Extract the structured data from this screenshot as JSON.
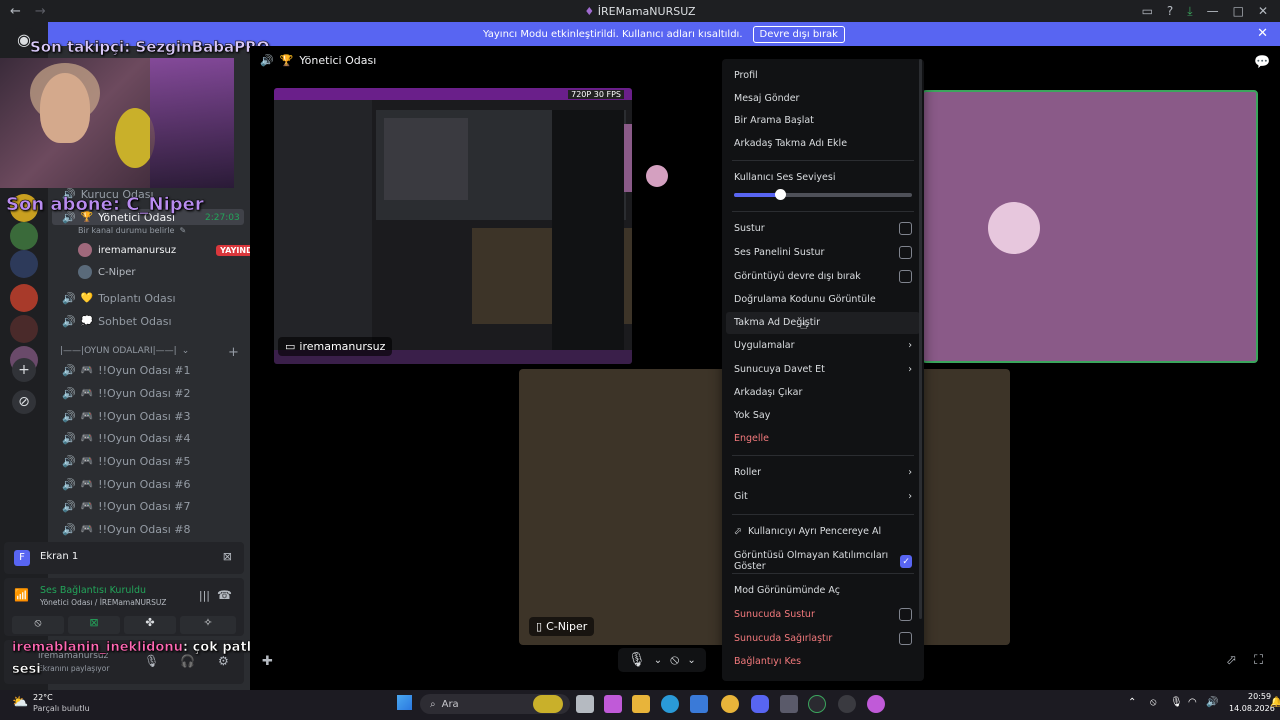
{
  "window": {
    "title": "İREMamaNURSUZ",
    "nav_back": "←",
    "nav_forward": "→",
    "right_icons": [
      "inbox-icon",
      "help-icon",
      "download-icon",
      "minimize-icon",
      "maximize-icon",
      "close-icon"
    ]
  },
  "banner": {
    "message": "Yayıncı Modu etkinleştirildi. Kullanıcı adları kısaltıldı.",
    "button": "Devre dışı bırak",
    "close": "✕"
  },
  "overlay": {
    "last_follower": "Son takipçi: SezginBabaPRO",
    "last_sub": "Son abone: C_Niper",
    "chat_user": "iremablanin_ineklidonu",
    "chat_text": ": çok patlıyor",
    "chat_text_2": "sesi"
  },
  "sidebar": {
    "channels_top": [
      {
        "label": "Kurucu Odası"
      },
      {
        "label": "Yönetici Odası",
        "timer": "2:27:03",
        "status": "Bir kanal durumu belirle"
      }
    ],
    "voice_users": [
      {
        "name": "iremamanursuz",
        "badge": "YAYINDA"
      },
      {
        "name": "C-Niper"
      }
    ],
    "channels_mid": [
      "Toplantı Odası",
      "Sohbet Odası"
    ],
    "category": "|——|OYUN ODALARI|——|",
    "game_rooms": [
      "!!Oyun Odası #1",
      "!!Oyun Odası #2",
      "!!Oyun Odası #3",
      "!!Oyun Odası #4",
      "!!Oyun Odası #5",
      "!!Oyun Odası #6",
      "!!Oyun Odası #7",
      "!!Oyun Odası #8"
    ],
    "screen_panel": {
      "label": "Ekran 1",
      "initial": "F"
    },
    "voice_panel": {
      "status": "Ses Bağlantısı Kuruldu",
      "location": "Yönetici Odası / İREMamaNURSUZ"
    },
    "user_panel": {
      "name": "iremamanursuz",
      "sub": "Ekranını paylaşıyor"
    }
  },
  "stage": {
    "channel": "Yönetici Odası",
    "screen_label": "iremamanursuz",
    "brown_label": "C-Niper",
    "inner_quality": "720P 30 FPS"
  },
  "context_menu": {
    "profile": "Profil",
    "message": "Mesaj Gönder",
    "call": "Bir Arama Başlat",
    "nickname_friend": "Arkadaş Takma Adı Ekle",
    "volume_label": "Kullanıcı Ses Seviyesi",
    "volume_level": 0.26,
    "mute": "Sustur",
    "mute_soundboard": "Ses Panelini Sustur",
    "disable_video": "Görüntüyü devre dışı bırak",
    "verify_code": "Doğrulama Kodunu Görüntüle",
    "change_nickname": "Takma Ad Değiştir",
    "apps": "Uygulamalar",
    "invite": "Sunucuya Davet Et",
    "remove_friend": "Arkadaşı Çıkar",
    "ignore": "Yok Say",
    "block": "Engelle",
    "roles": "Roller",
    "go": "Git",
    "popout": "Kullanıcıyı Ayrı Pencereye Al",
    "show_non_video": "Görüntüsü Olmayan Katılımcıları Göster",
    "mod_view": "Mod Görünümünde Aç",
    "server_mute": "Sunucuda Sustur",
    "server_deafen": "Sunucuda Sağırlaştır",
    "disconnect": "Bağlantıyı Kes"
  },
  "taskbar": {
    "weather_temp": "22°C",
    "weather_desc": "Parçalı bulutlu",
    "search": "Ara",
    "time": "20:59",
    "date": "14.08.2026"
  }
}
